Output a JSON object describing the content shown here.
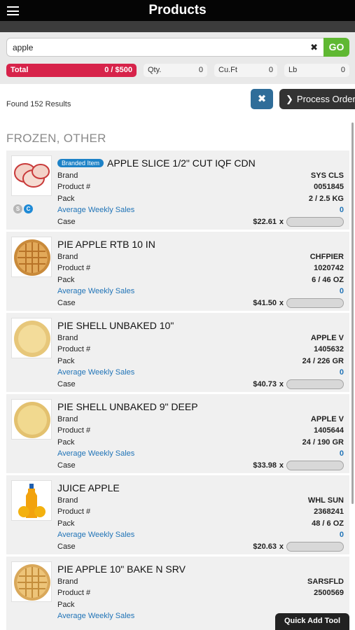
{
  "header": {
    "title": "Products"
  },
  "search": {
    "value": "apple",
    "clear": "✖",
    "go": "GO"
  },
  "totals": {
    "total_label": "Total",
    "total_value": "0 / $500",
    "qty_label": "Qty.",
    "qty_value": "0",
    "cuft_label": "Cu.Ft",
    "cuft_value": "0",
    "lb_label": "Lb",
    "lb_value": "0"
  },
  "results": {
    "found": "Found 152 Results",
    "clear_button": "✖",
    "process_label": "Process Order",
    "process_chevron": "❯"
  },
  "category": "FROZEN, OTHER",
  "labels": {
    "brand": "Brand",
    "product": "Product #",
    "pack": "Pack",
    "aws": "Average Weekly Sales",
    "case": "Case",
    "x": "x"
  },
  "items": [
    {
      "name": "APPLE SLICE 1/2\" CUT IQF CDN",
      "branded": "Branded Item",
      "brand": "SYS CLS",
      "product": "0051845",
      "pack": "2 / 2.5 KG",
      "aws": "0",
      "price": "$22.61",
      "badge_s": "S",
      "badge_c": "C"
    },
    {
      "name": "PIE APPLE RTB 10 IN",
      "brand": "CHFPIER",
      "product": "1020742",
      "pack": "6 / 46 OZ",
      "aws": "0",
      "price": "$41.50"
    },
    {
      "name": "PIE SHELL UNBAKED 10\"",
      "brand": "APPLE V",
      "product": "1405632",
      "pack": "24 / 226 GR",
      "aws": "0",
      "price": "$40.73"
    },
    {
      "name": "PIE SHELL UNBAKED 9\" DEEP",
      "brand": "APPLE V",
      "product": "1405644",
      "pack": "24 / 190 GR",
      "aws": "0",
      "price": "$33.98"
    },
    {
      "name": "JUICE APPLE",
      "brand": "WHL SUN",
      "product": "2368241",
      "pack": "48 / 6 OZ",
      "aws": "0",
      "price": "$20.63"
    },
    {
      "name": "PIE APPLE 10\" BAKE N SRV",
      "brand": "SARSFLD",
      "product": "2500569",
      "pack": "",
      "aws": "",
      "price": ""
    }
  ],
  "quick_add": "Quick Add Tool"
}
